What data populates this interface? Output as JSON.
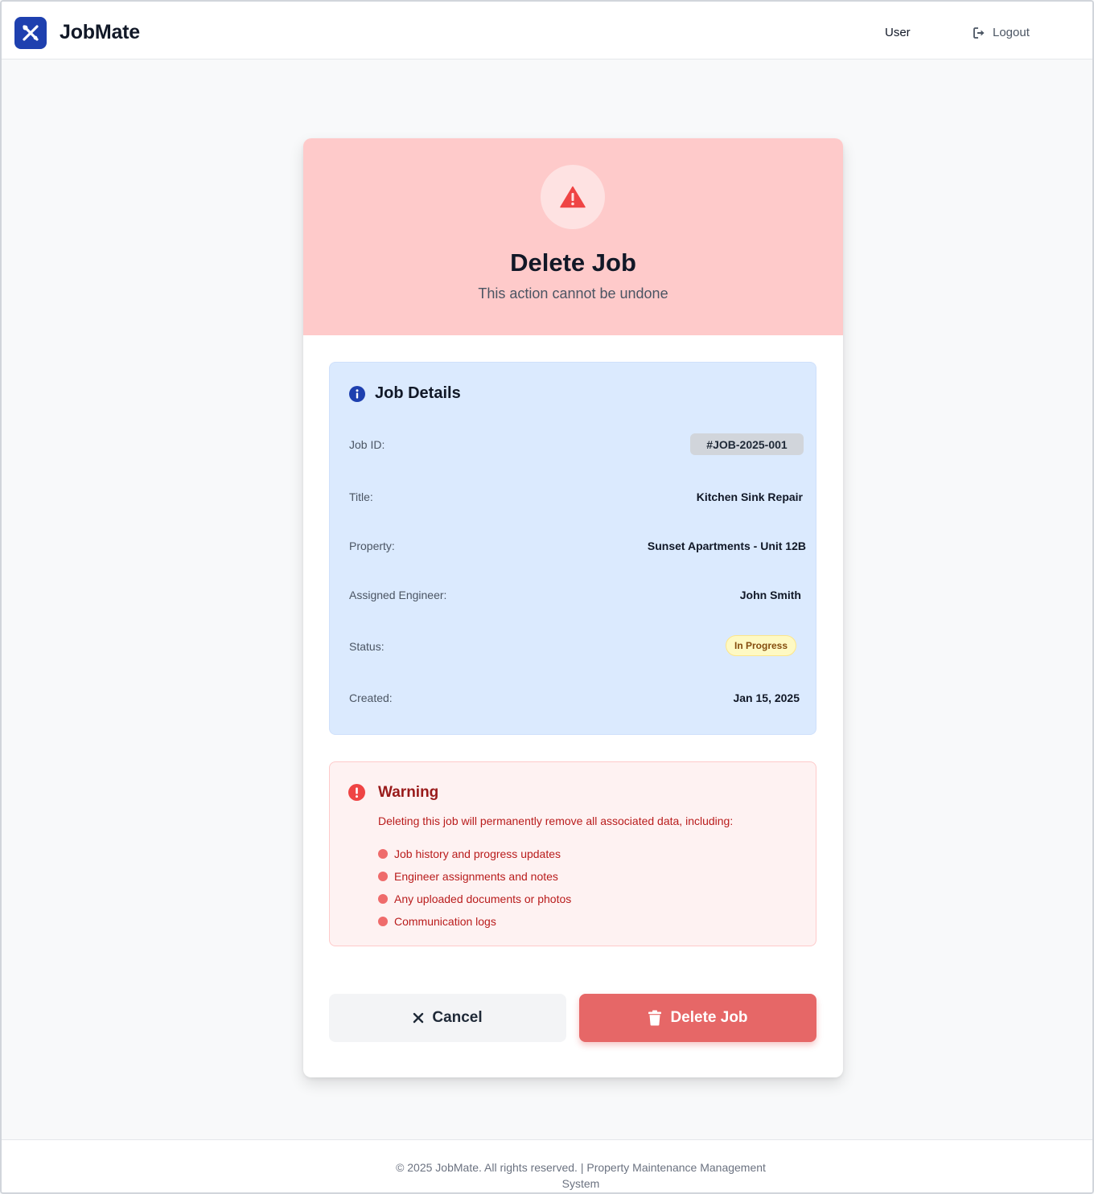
{
  "header": {
    "brand": "JobMate",
    "logo_icon": "tools-icon",
    "user_label": "User",
    "logout_label": "Logout"
  },
  "dialog": {
    "title": "Delete Job",
    "subtitle": "This action cannot be undone",
    "alert_icon": "warning-triangle-icon"
  },
  "details": {
    "title": "Job Details",
    "rows": {
      "job_id": {
        "label": "Job ID:",
        "value": "#JOB-2025-001"
      },
      "title": {
        "label": "Title:",
        "value": "Kitchen Sink Repair"
      },
      "property": {
        "label": "Property:",
        "value": "Sunset Apartments - Unit 12B"
      },
      "engineer": {
        "label": "Assigned Engineer:",
        "value": "John Smith"
      },
      "status": {
        "label": "Status:",
        "value": "In Progress"
      },
      "created": {
        "label": "Created:",
        "value": "Jan 15, 2025"
      }
    }
  },
  "warning": {
    "title": "Warning",
    "text": "Deleting this job will permanently remove all associated data, including:",
    "items": [
      "Job history and progress updates",
      "Engineer assignments and notes",
      "Any uploaded documents or photos",
      "Communication logs"
    ]
  },
  "actions": {
    "cancel_label": "Cancel",
    "delete_label": "Delete Job"
  },
  "footer": {
    "text": "© 2025 JobMate. All rights reserved. | Property Maintenance Management System"
  },
  "colors": {
    "brand": "#1e40af",
    "danger": "#e66767",
    "danger_header_bg": "#fecaca",
    "details_bg": "#dbeafe",
    "warning_bg": "#fef2f2"
  }
}
